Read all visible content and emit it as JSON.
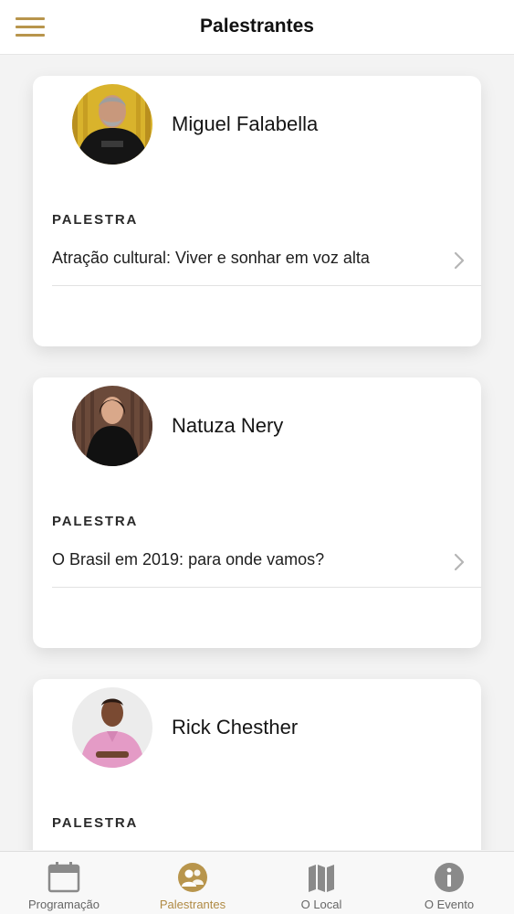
{
  "header": {
    "title": "Palestrantes",
    "menu_icon": "hamburger-menu-icon"
  },
  "speakers": [
    {
      "name": "Miguel Falabella",
      "section_label": "PALESTRA",
      "talk": "Atração cultural: Viver e sonhar em voz alta",
      "avatar_icon": "avatar-photo"
    },
    {
      "name": "Natuza Nery",
      "section_label": "PALESTRA",
      "talk": "O Brasil em 2019: para onde vamos?",
      "avatar_icon": "avatar-photo"
    },
    {
      "name": "Rick Chesther",
      "section_label": "PALESTRA",
      "talk": "",
      "avatar_icon": "avatar-photo"
    }
  ],
  "tabs": [
    {
      "label": "Programação",
      "icon": "calendar-icon",
      "active": false
    },
    {
      "label": "Palestrantes",
      "icon": "speakers-icon",
      "active": true
    },
    {
      "label": "O Local",
      "icon": "map-icon",
      "active": false
    },
    {
      "label": "O Evento",
      "icon": "info-icon",
      "active": false
    }
  ],
  "colors": {
    "accent": "#b8954c",
    "tab_inactive": "#8a8a8a",
    "background": "#f3f3f3"
  }
}
